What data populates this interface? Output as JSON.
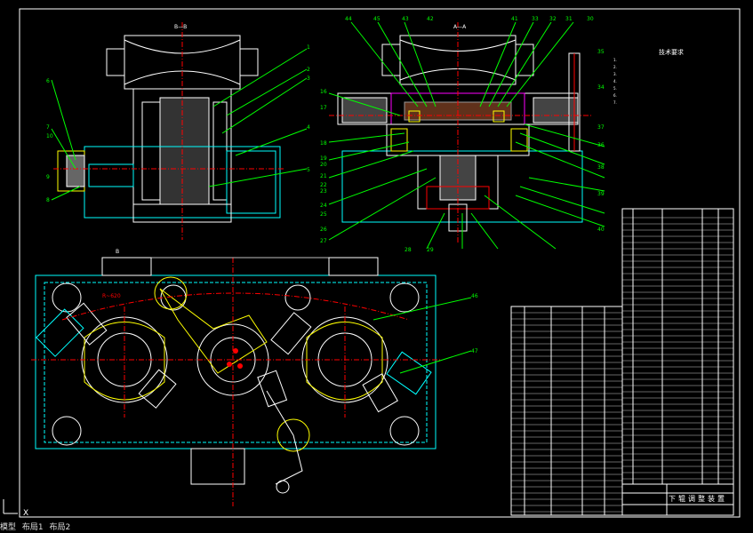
{
  "view_labels": {
    "top_left": "B—B",
    "top_right": "A—A",
    "main_B": "B",
    "main_radius": "R~620"
  },
  "tech_requirements": {
    "title": "技术要求",
    "items": [
      "1.",
      "2.",
      "3.",
      "4.",
      "5.",
      "6.",
      "7."
    ]
  },
  "title_block": {
    "name": "下辊调整装置"
  },
  "callouts_top": [
    "44",
    "45",
    "43",
    "42",
    "41",
    "33",
    "32",
    "31",
    "30"
  ],
  "callouts_right": [
    "35",
    "34",
    "37",
    "36",
    "38",
    "39",
    "40"
  ],
  "callouts_left": [
    "16",
    "17",
    "18",
    "19",
    "20",
    "21",
    "22",
    "23",
    "24",
    "25",
    "26",
    "27"
  ],
  "callouts_bottom": [
    "28",
    "29"
  ],
  "left_view_callouts": [
    "1",
    "2",
    "3",
    "4",
    "5",
    "6",
    "7",
    "8",
    "9",
    "10"
  ],
  "main_callouts": [
    "46",
    "47"
  ],
  "layout_tabs": [
    "模型",
    "布局1",
    "布局2"
  ],
  "colors": {
    "background": "#000000",
    "outline": "#ffffff",
    "cyan": "#00ffff",
    "green": "#00ff00",
    "red": "#ff0000",
    "yellow": "#ffff00",
    "magenta": "#ff00ff"
  }
}
